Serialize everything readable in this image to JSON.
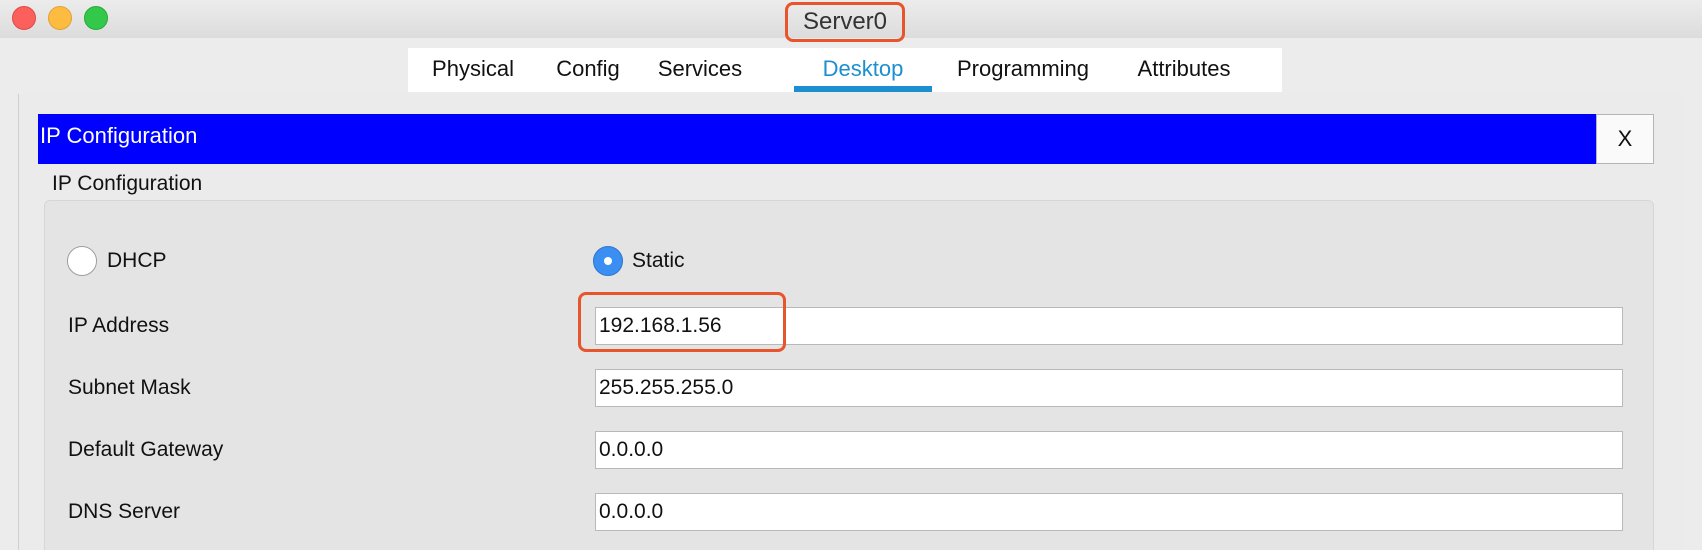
{
  "window": {
    "title": "Server0"
  },
  "tabs": [
    {
      "label": "Physical"
    },
    {
      "label": "Config"
    },
    {
      "label": "Services"
    },
    {
      "label": "Desktop",
      "active": true
    },
    {
      "label": "Programming"
    },
    {
      "label": "Attributes"
    }
  ],
  "panel": {
    "header_title": "IP Configuration",
    "close_label": "X",
    "section_label": "IP Configuration",
    "mode": {
      "dhcp_label": "DHCP",
      "static_label": "Static",
      "selected": "Static"
    },
    "fields": [
      {
        "label": "IP Address",
        "value": "192.168.1.56"
      },
      {
        "label": "Subnet Mask",
        "value": "255.255.255.0"
      },
      {
        "label": "Default Gateway",
        "value": "0.0.0.0"
      },
      {
        "label": "DNS Server",
        "value": "0.0.0.0"
      }
    ]
  },
  "colors": {
    "header_bg": "#0000ff",
    "active_tab": "#1b8fd0",
    "annotation": "#e8542b",
    "radio_selected": "#3b8ef2"
  },
  "icons": {
    "close": "close-window-icon",
    "minimize": "minimize-window-icon",
    "maximize": "maximize-window-icon"
  }
}
